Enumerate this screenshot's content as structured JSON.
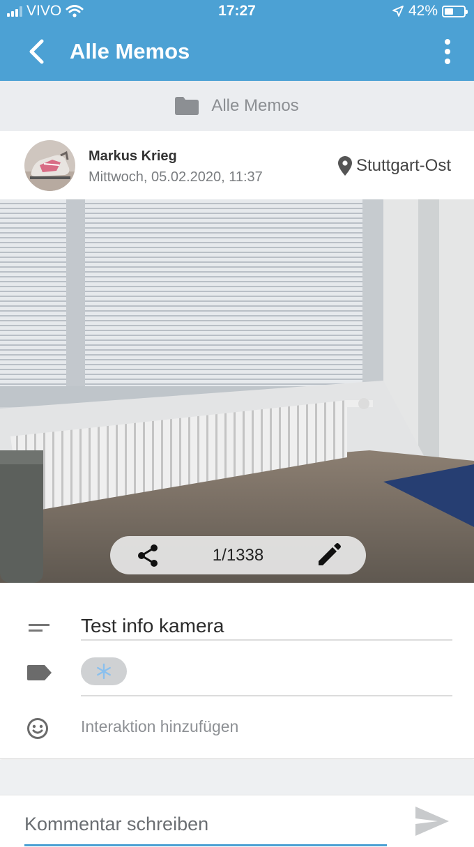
{
  "status_bar": {
    "carrier": "VIVO",
    "time": "17:27",
    "battery": "42%"
  },
  "header": {
    "title": "Alle Memos"
  },
  "folder": {
    "name": "Alle Memos"
  },
  "memo": {
    "author": "Markus Krieg",
    "date": "Mittwoch, 05.02.2020, 11:37",
    "location": "Stuttgart-Ost",
    "counter": "1/1338",
    "text": "Test info kamera",
    "tag_icon": "snowflake-emoji",
    "interaction_label": "Interaktion hinzufügen"
  },
  "comment": {
    "placeholder": "Kommentar schreiben"
  },
  "colors": {
    "accent": "#4ca1d4",
    "folder_bar": "#ebedf0"
  }
}
